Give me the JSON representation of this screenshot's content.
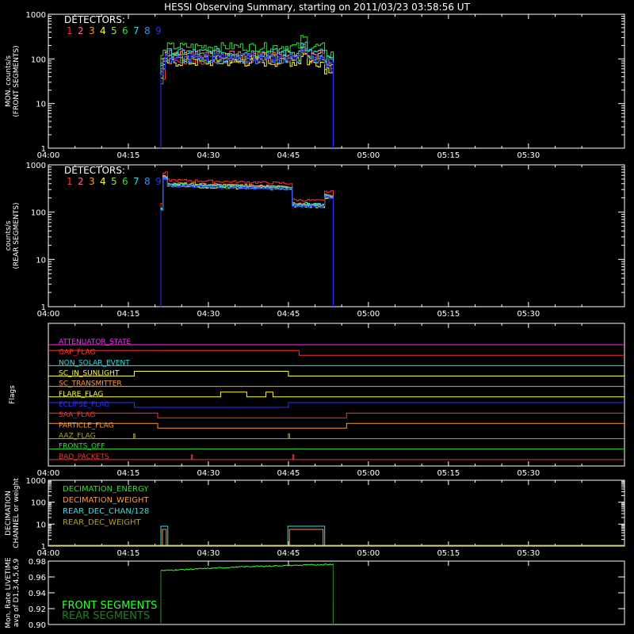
{
  "title": "HESSI Observing Summary, starting on 2011/03/23 03:58:56 UT",
  "time_ticks": [
    "04:00",
    "04:15",
    "04:30",
    "04:45",
    "05:00",
    "05:15",
    "05:30"
  ],
  "detector_colors": [
    "#ff3030",
    "#ff69b4",
    "#ff9a30",
    "#ffff30",
    "#a0e020",
    "#30e030",
    "#30e0e0",
    "#3090ff",
    "#3030ff"
  ],
  "chart_data": [
    {
      "type": "line",
      "id": "front",
      "ylabel": [
        "MON. counts/s",
        "(FRONT SEGMENTS)"
      ],
      "yscale": "log",
      "ylim": [
        1,
        1000
      ],
      "yticks": [
        "1",
        "10",
        "100",
        "1000"
      ],
      "legend_title": "DETECTORS:",
      "legend_numbers": [
        "1",
        "2",
        "3",
        "4",
        "5",
        "6",
        "7",
        "8",
        "9"
      ],
      "x_range_min": [
        0,
        48
      ],
      "data_start_min": 21.1,
      "data_end_min": 53.4,
      "series_levels_counts": [
        95,
        130,
        120,
        85,
        105,
        190,
        140,
        100,
        110
      ],
      "spike_at_min": 47.6
    },
    {
      "type": "line",
      "id": "rear",
      "ylabel": [
        "counts/s",
        "(REAR SEGMENTS)"
      ],
      "yscale": "log",
      "ylim": [
        1,
        1000
      ],
      "yticks": [
        "1",
        "10",
        "100",
        "1000"
      ],
      "legend_title": "DETECTORS:",
      "legend_numbers": [
        "1",
        "2",
        "3",
        "4",
        "5",
        "6",
        "7",
        "8",
        "9"
      ],
      "data_start_min": 21.1,
      "data_end_min": 53.4,
      "series_levels_counts": [
        400,
        330,
        340,
        300,
        310,
        320,
        330,
        310,
        300
      ]
    },
    {
      "type": "line",
      "id": "flags",
      "ylabel": [
        "Flags"
      ],
      "flags": [
        {
          "name": "ATTENUATOR_STATE",
          "color": "#ff30ff",
          "steps": []
        },
        {
          "name": "GAP_FLAG",
          "color": "#ff3030",
          "steps": [
            [
              21.1,
              1
            ],
            [
              47.0,
              0
            ]
          ]
        },
        {
          "name": "NON_SOLAR_EVENT",
          "color": "#30e0e0",
          "steps": []
        },
        {
          "name": "SC_IN_SUNLIGHT",
          "color": "#ffff30",
          "steps": [
            [
              0,
              0
            ],
            [
              16.1,
              1
            ],
            [
              45.0,
              0
            ]
          ]
        },
        {
          "name": "SC_TRANSMITTER",
          "color": "#ff9a30",
          "steps": []
        },
        {
          "name": "FLARE_FLAG",
          "color": "#ffff30",
          "steps": [
            [
              0,
              0
            ],
            [
              32.3,
              1
            ],
            [
              37.2,
              0
            ],
            [
              40.8,
              1
            ],
            [
              42.1,
              0
            ]
          ]
        },
        {
          "name": "ECLIPSE_FLAG",
          "color": "#3030ff",
          "steps": [
            [
              0,
              1
            ],
            [
              16.1,
              0
            ],
            [
              45.0,
              1
            ]
          ]
        },
        {
          "name": "SAA_FLAG",
          "color": "#ff3030",
          "steps": [
            [
              0,
              1
            ],
            [
              20.5,
              0
            ],
            [
              55.9,
              1
            ]
          ]
        },
        {
          "name": "PARTICLE_FLAG",
          "color": "#ff9a30",
          "steps": [
            [
              0,
              1
            ],
            [
              20.5,
              0
            ],
            [
              55.9,
              1
            ]
          ]
        },
        {
          "name": "AAZ_FLAG",
          "color": "#b0a020",
          "steps": [],
          "blips": [
            16.0,
            45.0
          ]
        },
        {
          "name": "FRONTS_OFF",
          "color": "#30e030",
          "steps": []
        },
        {
          "name": "BAD_PACKETS",
          "color": "#ff3030",
          "steps": [],
          "blips": [
            26.8,
            45.8
          ]
        }
      ]
    },
    {
      "type": "line",
      "id": "decimation",
      "ylabel": [
        "DECIMATION",
        "CHANNEL or weight"
      ],
      "yscale": "log",
      "ylim": [
        1,
        1000
      ],
      "yticks": [
        "1",
        "10",
        "100",
        "1000"
      ],
      "legend": [
        {
          "name": "DECIMATION_ENERGY",
          "color": "#30e030"
        },
        {
          "name": "DECIMATION_WEIGHT",
          "color": "#ff9a30"
        },
        {
          "name": "REAR_DEC_CHAN/128",
          "color": "#30e0e0"
        },
        {
          "name": "REAR_DEC_WEIGHT",
          "color": "#b0a020"
        }
      ],
      "rear_dec_windows_min": [
        [
          14.6,
          15.9
        ],
        [
          38.4,
          45.3
        ]
      ],
      "rear_dec_value": 8
    },
    {
      "type": "line",
      "id": "livetime",
      "ylabel": [
        "Mon. Rate LIVETIME",
        "avg of D1,3,4,5,6,9"
      ],
      "ylim": [
        0.9,
        0.98
      ],
      "yticks": [
        "0.90",
        "0.92",
        "0.94",
        "0.96",
        "0.98"
      ],
      "legend": [
        {
          "name": "FRONT SEGMENTS",
          "color": "#30ff30"
        },
        {
          "name": "REAR SEGMENTS",
          "color": "#208020"
        }
      ],
      "data_start_min": 21.1,
      "data_end_min": 53.4,
      "front_start": 0.968,
      "front_mid": 0.973,
      "front_end": 0.976
    }
  ]
}
